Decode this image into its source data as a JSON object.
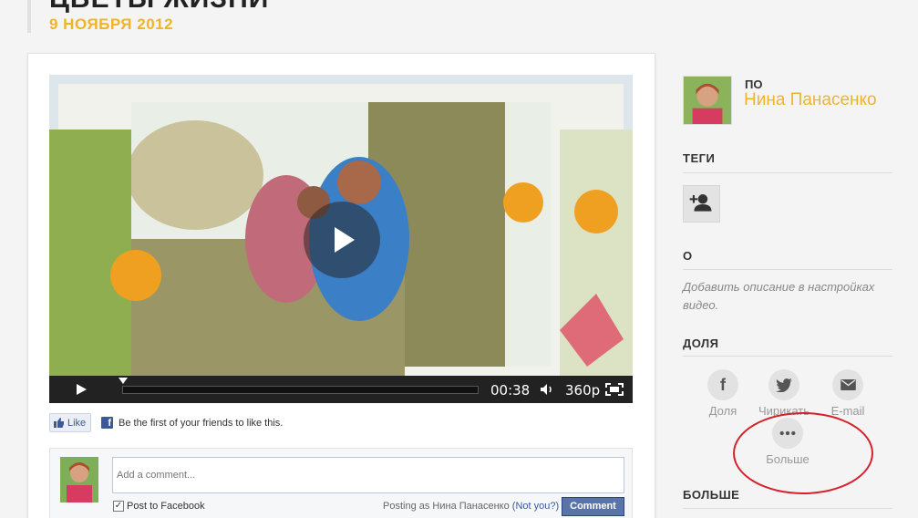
{
  "header": {
    "title": "ЦВЕТЫ ЖИЗНИ",
    "date": "9 НОЯБРЯ 2012"
  },
  "video": {
    "time": "00:38",
    "quality": "360p",
    "progress_fraction": 0.0
  },
  "facebook": {
    "like_label": "Like",
    "like_message": "Be the first of your friends to like this.",
    "comment_placeholder": "Add a comment...",
    "post_to_facebook": "Post to Facebook",
    "posting_as": "Posting as Нина Панасенко",
    "not_you": "(Not you?)",
    "comment_button": "Comment"
  },
  "sidebar": {
    "by_label": "ПО",
    "author": "Нина Панасенко",
    "tags_heading": "ТЕГИ",
    "about_heading": "О",
    "about_text": "Добавить описание в настройках видео.",
    "share_heading": "ДОЛЯ",
    "share_items": [
      {
        "label": "Доля",
        "icon": "facebook-icon"
      },
      {
        "label": "Чирикать",
        "icon": "twitter-icon"
      },
      {
        "label": "E-mail",
        "icon": "email-icon"
      },
      {
        "label": "Больше",
        "icon": "more-icon"
      }
    ],
    "more_heading": "БОЛЬШЕ"
  },
  "colors": {
    "accent": "#f0b429",
    "highlight": "#d6202a",
    "facebook": "#3b5998"
  }
}
